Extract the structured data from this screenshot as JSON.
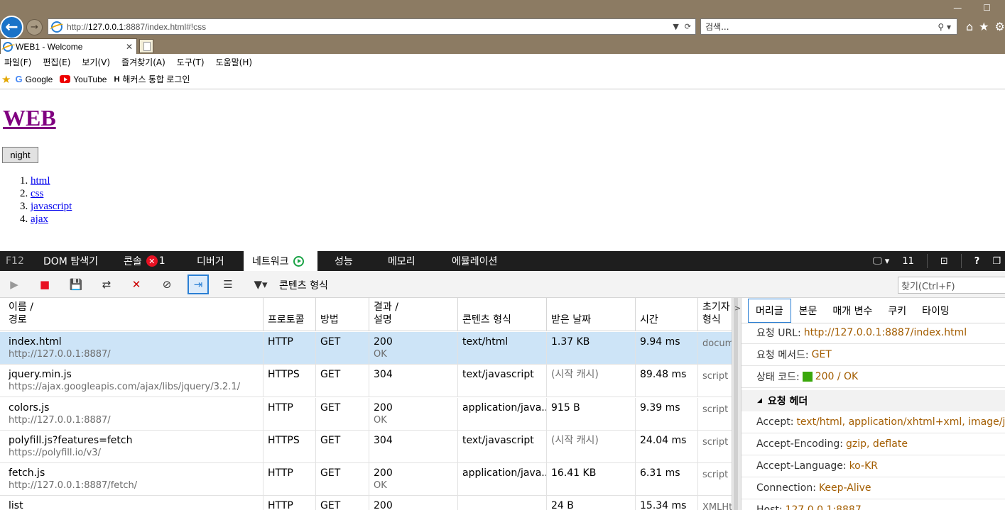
{
  "browser": {
    "url_prefix": "http://",
    "url_host": "127.0.0.1",
    "url_rest": ":8887/index.html#!css",
    "search_placeholder": "검색...",
    "tab_title": "WEB1 - Welcome",
    "menu": [
      "파일(F)",
      "편집(E)",
      "보기(V)",
      "즐겨찾기(A)",
      "도구(T)",
      "도움말(H)"
    ],
    "favorites": [
      "Google",
      "YouTube",
      "해커스 통합 로그인"
    ]
  },
  "page": {
    "title": "WEB",
    "night_button": "night",
    "list": [
      "html",
      "css",
      "javascript",
      "ajax"
    ]
  },
  "devtools": {
    "f12": "F12",
    "tabs": [
      "DOM 탐색기",
      "콘솔",
      "디버거",
      "네트워크",
      "성능",
      "메모리",
      "에뮬레이션"
    ],
    "console_errors": "1",
    "right_count": "11",
    "filter_label": "콘텐츠 형식",
    "find_placeholder": "찾기(Ctrl+F)",
    "columns": {
      "name_1": "이름 /",
      "name_2": "경로",
      "protocol": "프로토콜",
      "method": "방법",
      "result_1": "결과 /",
      "result_2": "설명",
      "type": "콘텐츠 형식",
      "received": "받은 날짜",
      "time": "시간",
      "initiator_1": "초기자",
      "initiator_2": "형식"
    },
    "rows": [
      {
        "name": "index.html",
        "path": "http://127.0.0.1:8887/",
        "protocol": "HTTP",
        "method": "GET",
        "result": "200",
        "desc": "OK",
        "type": "text/html",
        "received": "1.37 KB",
        "time": "9.94 ms",
        "initiator": "document"
      },
      {
        "name": "jquery.min.js",
        "path": "https://ajax.googleapis.com/ajax/libs/jquery/3.2.1/",
        "protocol": "HTTPS",
        "method": "GET",
        "result": "304",
        "desc": "",
        "type": "text/javascript",
        "received": "(시작 캐시)",
        "time": "89.48 ms",
        "initiator": "script"
      },
      {
        "name": "colors.js",
        "path": "http://127.0.0.1:8887/",
        "protocol": "HTTP",
        "method": "GET",
        "result": "200",
        "desc": "OK",
        "type": "application/java...",
        "received": "915 B",
        "time": "9.39 ms",
        "initiator": "script"
      },
      {
        "name": "polyfill.js?features=fetch",
        "path": "https://polyfill.io/v3/",
        "protocol": "HTTPS",
        "method": "GET",
        "result": "304",
        "desc": "",
        "type": "text/javascript",
        "received": "(시작 캐시)",
        "time": "24.04 ms",
        "initiator": "script"
      },
      {
        "name": "fetch.js",
        "path": "http://127.0.0.1:8887/fetch/",
        "protocol": "HTTP",
        "method": "GET",
        "result": "200",
        "desc": "OK",
        "type": "application/java...",
        "received": "16.41 KB",
        "time": "6.31 ms",
        "initiator": "script"
      },
      {
        "name": "list",
        "path": "",
        "protocol": "HTTP",
        "method": "GET",
        "result": "200",
        "desc": "",
        "type": "",
        "received": "24 B",
        "time": "15.34 ms",
        "initiator": "XMLHttp"
      }
    ],
    "details": {
      "tabs": [
        "머리글",
        "본문",
        "매개 변수",
        "쿠키",
        "타이밍"
      ],
      "request_url_k": "요청 URL:",
      "request_url_v": "http://127.0.0.1:8887/index.html",
      "method_k": "요청 메서드:",
      "method_v": "GET",
      "status_k": "상태 코드:",
      "status_v": "200 / OK",
      "section": "요청 헤더",
      "headers": [
        {
          "k": "Accept:",
          "v": "text/html, application/xhtml+xml, image/jxr, */*"
        },
        {
          "k": "Accept-Encoding:",
          "v": "gzip, deflate"
        },
        {
          "k": "Accept-Language:",
          "v": "ko-KR"
        },
        {
          "k": "Connection:",
          "v": "Keep-Alive"
        },
        {
          "k": "Host:",
          "v": "127.0.0.1:8887"
        }
      ]
    }
  }
}
